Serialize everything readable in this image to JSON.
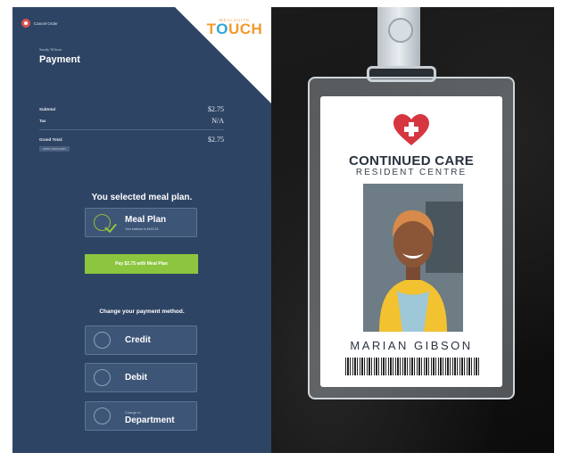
{
  "kiosk": {
    "brand": {
      "small": "MEALSUITE",
      "big_pre": "T",
      "big_o": "O",
      "big_post": "UCH"
    },
    "cancel_label": "Cancel Order",
    "user_name": "Sandy Wilson",
    "title": "Payment",
    "totals": [
      {
        "label": "Subtotal",
        "value": "$2.75"
      },
      {
        "label": "Tax",
        "value": "N/A"
      }
    ],
    "grand_total": {
      "label": "Grand Total:",
      "value": "$2.75"
    },
    "discount_button": "APPLY DISCOUNT",
    "selected_message": "You selected meal plan.",
    "meal_plan": {
      "label": "Meal Plan",
      "balance": "Your balance is $163.15"
    },
    "pay_button": "Pay $2.75 with Meal Plan",
    "change_message": "Change your payment method.",
    "methods": {
      "credit": "Credit",
      "debit": "Debit",
      "department_sub": "Charge to",
      "department": "Department"
    },
    "colors": {
      "panel": "#2e4464",
      "accent_green": "#8cc63f",
      "brand_orange": "#f39a2c",
      "cancel_red": "#d9534f"
    }
  },
  "badge": {
    "org_line1": "CONTINUED CARE",
    "org_line2": "RESIDENT CENTRE",
    "name": "MARIAN GIBSON",
    "colors": {
      "heart": "#d6363f"
    }
  }
}
